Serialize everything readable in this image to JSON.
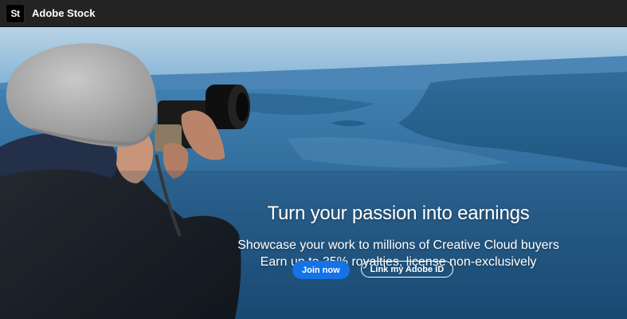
{
  "app": {
    "logo_text": "St",
    "title": "Adobe Stock"
  },
  "hero": {
    "headline": "Turn your passion into earnings",
    "subline_1": "Showcase your work to millions of Creative Cloud buyers",
    "subline_2": "Earn up to 35% royalties, license non-exclusively",
    "image_subject": "photographer-with-camera-over-lake"
  },
  "actions": {
    "join_label": "Join now",
    "link_label": "Link my Adobe ID"
  },
  "colors": {
    "topbar_bg": "#232323",
    "primary_button": "#1473e6"
  }
}
